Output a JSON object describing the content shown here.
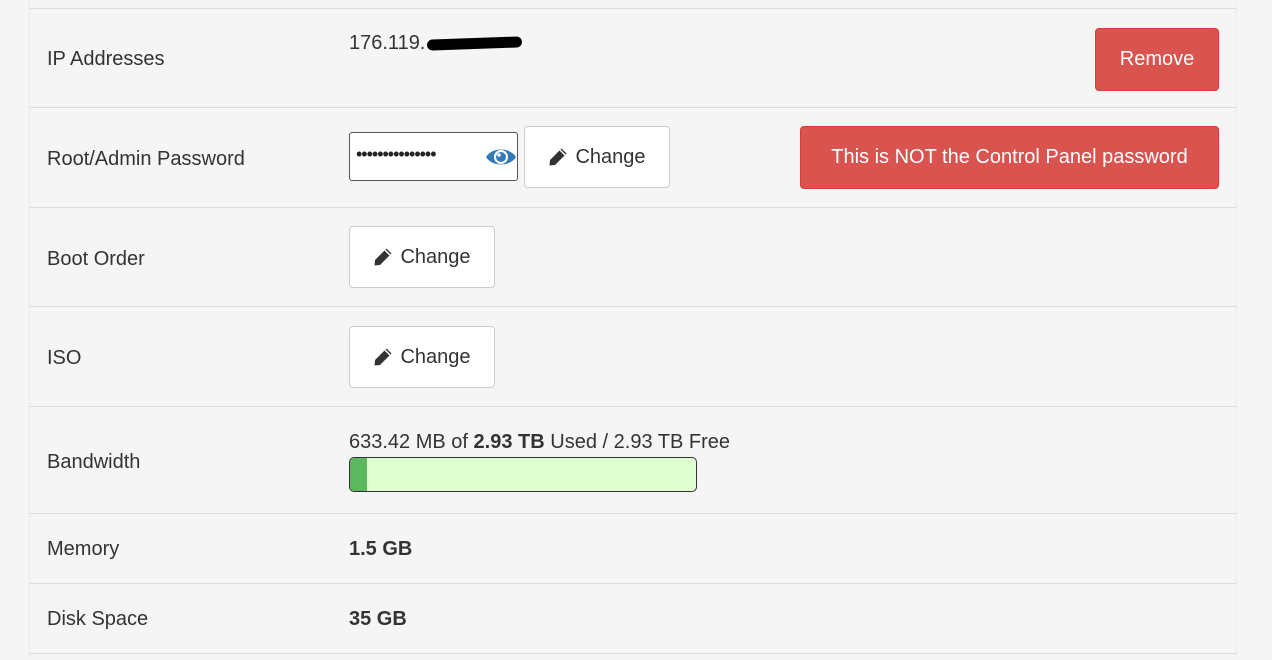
{
  "rows": {
    "ip": {
      "label": "IP Addresses",
      "value": "176.119.",
      "remove_label": "Remove"
    },
    "password": {
      "label": "Root/Admin Password",
      "masked_value": "•••••••••••••••",
      "change_label": "Change",
      "warning_label": "This is NOT the Control Panel password"
    },
    "boot": {
      "label": "Boot Order",
      "change_label": "Change"
    },
    "iso": {
      "label": "ISO",
      "change_label": "Change"
    },
    "bandwidth": {
      "label": "Bandwidth",
      "used": "633.42 MB",
      "of_text": "of",
      "total": "2.93 TB",
      "used_text": "Used /",
      "free": "2.93 TB Free",
      "used_fraction": 0.05
    },
    "memory": {
      "label": "Memory",
      "value": "1.5 GB"
    },
    "disk": {
      "label": "Disk Space",
      "value": "35 GB"
    }
  },
  "colors": {
    "danger": "#d9534f",
    "progress_fill": "#5cb85c",
    "progress_track": "#dfffd0",
    "eye": "#337ab7"
  },
  "icons": {
    "pencil": "pencil-icon",
    "eye": "eye-icon"
  }
}
